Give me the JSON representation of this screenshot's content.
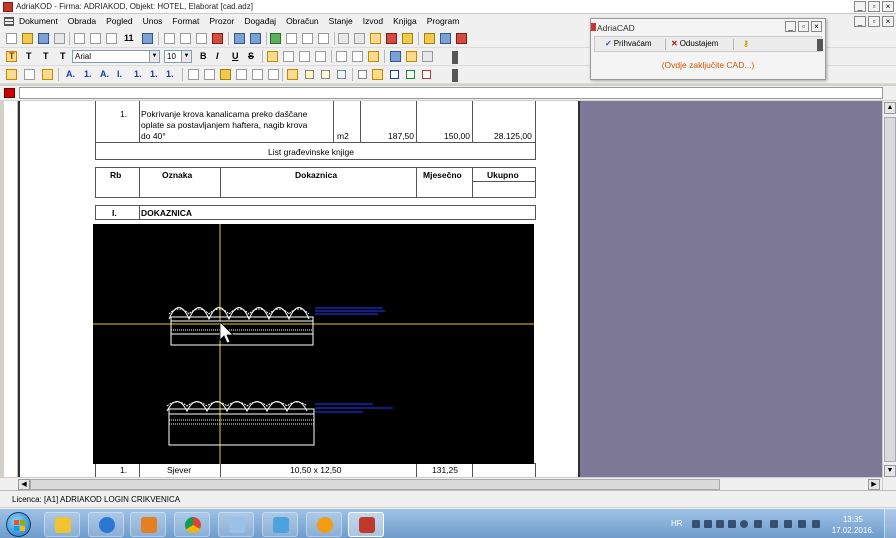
{
  "window": {
    "title": "AdriaKOD - Firma: ADRIAKOD,   Objekt: HOTEL, Elaborat [cad.adz]",
    "minimize": "_",
    "maximize": "▫",
    "close": "×"
  },
  "menu": {
    "items": [
      "Dokument",
      "Obrada",
      "Pogled",
      "Unos",
      "Format",
      "Prozor",
      "Događaj",
      "Obračun",
      "Stanje",
      "Izvod",
      "Knjiga",
      "Program"
    ]
  },
  "format_toolbar": {
    "font_name": "Arial",
    "font_size": "10",
    "bold": "B",
    "italic": "I",
    "underline": "U",
    "strike": "S",
    "text_style_buttons": [
      "T",
      "T",
      "T",
      "T"
    ]
  },
  "style_toolbar": {
    "labels": [
      "A.",
      "1.",
      "A.",
      "I.",
      "1.",
      "1.",
      "1."
    ]
  },
  "document": {
    "item_row": {
      "number": "1.",
      "description_lines": [
        "Pokrivanje krova kanalicama preko daščane",
        "oplate sa postavljanjem haftera, nagib krova",
        "do 40°"
      ],
      "unit": "m2",
      "quantity": "187,50",
      "price": "150,00",
      "total": "28.125,00"
    },
    "book_label": "List građevinske knjige",
    "table_headers": {
      "rb": "Rb",
      "oznaka": "Oznaka",
      "dokaznica": "Dokaznica",
      "mjesecno": "Mjesečno",
      "ukupno": "Ukupno"
    },
    "section": {
      "number": "I.",
      "title": "DOKAZNICA"
    },
    "bottom_row": {
      "number": "1.",
      "oznaka": "Sjever",
      "dokaznica": "10,50 x 12,50",
      "mjesecno": "131,25"
    }
  },
  "cad_panel": {
    "title": "AdriaCAD",
    "accept_label": "Prihvaćam",
    "cancel_label": "Odustajem",
    "message": "(Ovdje zaključite CAD...)"
  },
  "licence": {
    "text": "Licenca: [A1] ADRIAKOD LOGIN CRIKVENICA"
  },
  "taskbar": {
    "language": "HR",
    "time": "13:35",
    "date": "17.02.2016."
  },
  "colors": {
    "workspace_gray": "#7c7895",
    "drawing_bg": "#000000",
    "crosshair": "#e6d200",
    "annotation": "#1f3bff",
    "cad_message": "#d35400"
  }
}
